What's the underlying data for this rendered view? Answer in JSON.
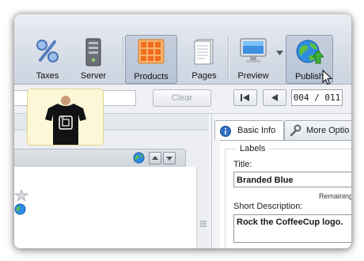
{
  "toolbar": {
    "buttons": [
      {
        "label": "Taxes",
        "icon": "percent-icon"
      },
      {
        "label": "Server",
        "icon": "server-icon"
      },
      {
        "label": "Products",
        "icon": "products-grid-icon",
        "active": true
      },
      {
        "label": "Pages",
        "icon": "pages-icon"
      },
      {
        "label": "Preview",
        "icon": "monitor-icon"
      },
      {
        "label": "Publish",
        "icon": "globe-upload-icon"
      }
    ]
  },
  "search": {
    "value": "",
    "clear_label": "Clear"
  },
  "pager": {
    "counter": "004 / 011"
  },
  "details": {
    "tabs": [
      {
        "label": "Basic Info",
        "icon": "info-icon"
      },
      {
        "label": "More Optio",
        "icon": "wrench-icon"
      }
    ],
    "labels_legend": "Labels",
    "title_label": "Title:",
    "title_value": "Branded Blue",
    "remaining_label": "Remaining",
    "short_desc_label": "Short Description:",
    "short_desc_value": "Rock the CoffeeCup logo."
  },
  "colors": {
    "toolbar_bg": "#d8dee8",
    "active_tab": "#ffffff",
    "thumb_bg": "#fdf7d8"
  }
}
